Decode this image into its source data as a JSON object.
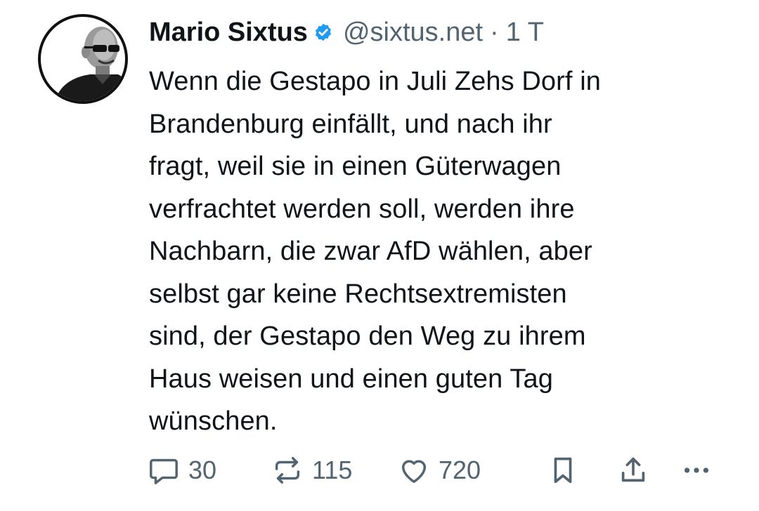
{
  "post": {
    "author": {
      "display_name": "Mario Sixtus",
      "verified": true,
      "handle": "@sixtus.net",
      "separator": "·",
      "timestamp": "1 T"
    },
    "text": "Wenn die Gestapo in Juli Zehs Dorf in\nBrandenburg einfällt, und nach ihr\nfragt, weil sie in einen Güterwagen\nverfrachtet werden soll, werden ihre\nNachbarn, die zwar AfD wählen, aber\nselbst gar keine Rechtsextremisten\nsind, der Gestapo den Weg zu ihrem\nHaus weisen und einen guten Tag\nwünschen.",
    "actions": {
      "replies": "30",
      "reposts": "115",
      "likes": "720"
    },
    "icons": {
      "reply": "reply-bubble-icon",
      "repost": "repost-arrows-icon",
      "like": "heart-icon",
      "bookmark": "bookmark-icon",
      "share": "share-icon",
      "more": "more-dots-icon",
      "verified": "verified-badge-icon"
    },
    "colors": {
      "text": "#0f1419",
      "muted": "#536471",
      "verified": "#1d9bf0"
    }
  }
}
